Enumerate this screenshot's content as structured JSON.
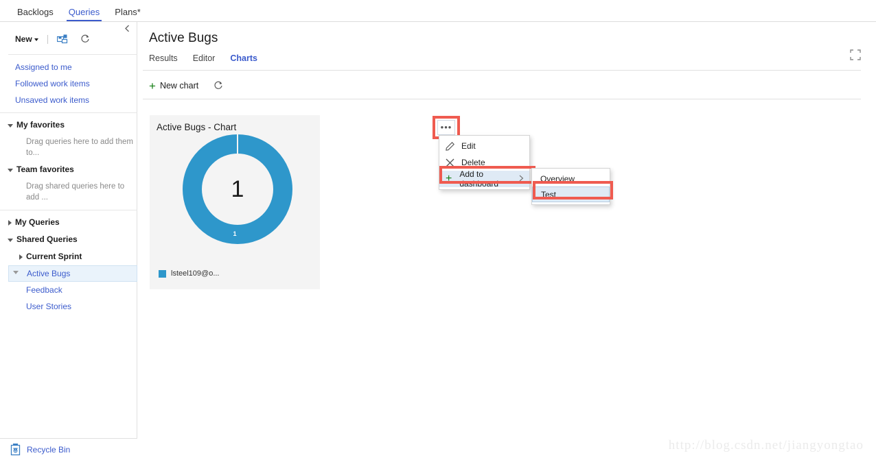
{
  "topnav": {
    "items": [
      {
        "label": "Backlogs",
        "active": false
      },
      {
        "label": "Queries",
        "active": true
      },
      {
        "label": "Plans*",
        "active": false
      }
    ]
  },
  "sidebar": {
    "collapse_icon": "chevron-left-icon",
    "toolbar": {
      "new_label": "New",
      "save_icon": "save-query-icon",
      "refresh_icon": "refresh-icon"
    },
    "links": [
      {
        "label": "Assigned to me"
      },
      {
        "label": "Followed work items"
      },
      {
        "label": "Unsaved work items"
      }
    ],
    "groups": [
      {
        "label": "My favorites",
        "expanded": true,
        "hint": "Drag queries here to add them to..."
      },
      {
        "label": "Team favorites",
        "expanded": true,
        "hint": "Drag shared queries here to add ..."
      }
    ],
    "my_queries": {
      "label": "My Queries",
      "expanded": false
    },
    "shared_queries": {
      "label": "Shared Queries",
      "expanded": true
    },
    "current_sprint": {
      "label": "Current Sprint",
      "expanded": false
    },
    "children": [
      {
        "label": "Active Bugs",
        "selected": true
      },
      {
        "label": "Feedback",
        "selected": false
      },
      {
        "label": "User Stories",
        "selected": false
      }
    ],
    "recycle_bin": {
      "label": "Recycle Bin",
      "icon": "recycle-bin-icon"
    }
  },
  "main": {
    "page_title": "Active Bugs",
    "tabs": [
      {
        "label": "Results",
        "active": false
      },
      {
        "label": "Editor",
        "active": false
      },
      {
        "label": "Charts",
        "active": true
      }
    ],
    "fullscreen_icon": "fullscreen-icon",
    "commandbar": {
      "new_chart_label": "New chart",
      "new_chart_icon": "plus-icon",
      "refresh_icon": "refresh-icon"
    }
  },
  "chart_card": {
    "title": "Active Bugs - Chart",
    "ellipsis_label": "•••",
    "ellipsis_icon": "more-actions-icon"
  },
  "chart_data": {
    "type": "pie",
    "variant": "donut",
    "title": "Active Bugs - Chart",
    "center_label": "1",
    "total": 1,
    "categories": [
      "lsteel109@o..."
    ],
    "values": [
      1
    ],
    "data_labels": [
      "1"
    ],
    "colors": [
      "#2e97cb"
    ],
    "legend": [
      {
        "label": "lsteel109@o...",
        "color": "#2e97cb",
        "value": 1
      }
    ],
    "legend_position": "bottom-left",
    "grid": false
  },
  "context_menu": {
    "items": [
      {
        "label": "Edit",
        "icon": "pencil-icon",
        "highlighted": false,
        "has_submenu": false
      },
      {
        "label": "Delete",
        "icon": "close-x-icon",
        "highlighted": false,
        "has_submenu": false
      },
      {
        "label": "Add to dashboard",
        "icon": "plus-icon",
        "highlighted": true,
        "has_submenu": true
      }
    ]
  },
  "submenu": {
    "items": [
      {
        "label": "Overview",
        "selected": false
      },
      {
        "label": "Test",
        "selected": true
      }
    ]
  },
  "watermark": {
    "text": "http://blog.csdn.net/jiangyongtao"
  },
  "colors": {
    "accent_blue": "#3b5bcc",
    "link_blue": "#3b5bcc",
    "chart_blue": "#2e97cb",
    "highlight_red": "#ef5b50",
    "menu_highlight": "#dfeaf5",
    "green_plus": "#107c10"
  }
}
